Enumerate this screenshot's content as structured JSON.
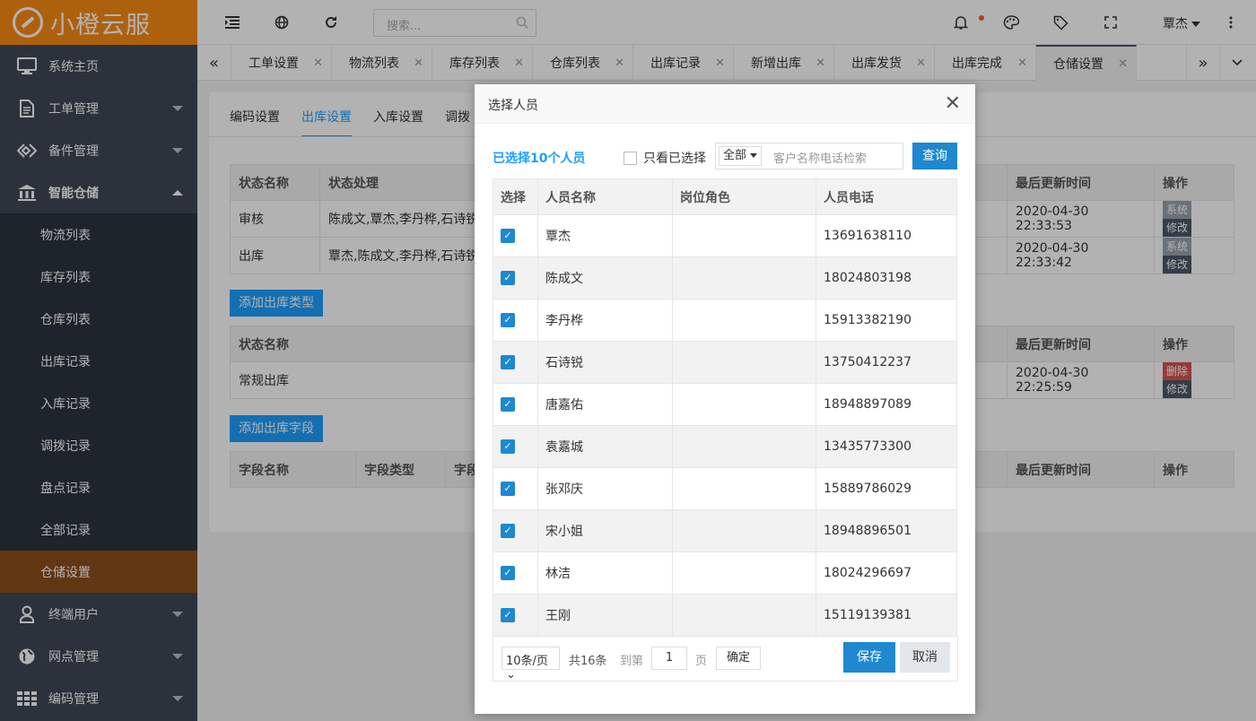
{
  "app": {
    "logo_text": "小橙云服"
  },
  "sidebar": {
    "top_items": [
      {
        "label": "系统主页",
        "icon": "monitor-icon"
      },
      {
        "label": "工单管理",
        "icon": "document-icon"
      },
      {
        "label": "备件管理",
        "icon": "parts-icon"
      },
      {
        "label": "智能仓储",
        "icon": "bank-icon"
      }
    ],
    "sub_items": [
      "物流列表",
      "库存列表",
      "仓库列表",
      "出库记录",
      "入库记录",
      "调拨记录",
      "盘点记录",
      "全部记录",
      "仓储设置"
    ],
    "bottom_items": [
      {
        "label": "终端用户",
        "icon": "user-icon"
      },
      {
        "label": "网点管理",
        "icon": "globe-icon"
      },
      {
        "label": "编码管理",
        "icon": "grid-icon"
      }
    ]
  },
  "topbar": {
    "search_placeholder": "搜索...",
    "user_name": "覃杰"
  },
  "tabs": [
    "工单设置",
    "物流列表",
    "库存列表",
    "仓库列表",
    "出库记录",
    "新增出库",
    "出库发货",
    "出库完成",
    "仓储设置"
  ],
  "page": {
    "subtabs": [
      "编码设置",
      "出库设置",
      "入库设置",
      "调拨"
    ],
    "table1": {
      "headers": [
        "状态名称",
        "状态处理",
        "最后更新时间",
        "操作"
      ],
      "rows": [
        {
          "name": "审核",
          "handler": "陈成文,覃杰,李丹桦,石诗锐",
          "time": "2020-04-30 22:33:53"
        },
        {
          "name": "出库",
          "handler": "覃杰,陈成文,李丹桦,石诗锐",
          "time": "2020-04-30 22:33:42"
        }
      ]
    },
    "add_type_btn": "添加出库类型",
    "table2": {
      "headers": [
        "状态名称",
        "最后更新时间",
        "操作"
      ],
      "rows": [
        {
          "name": "常规出库",
          "time": "2020-04-30 22:25:59"
        }
      ]
    },
    "add_field_btn": "添加出库字段",
    "table3": {
      "headers": [
        "字段名称",
        "字段类型",
        "字段",
        "最后更新时间",
        "操作"
      ]
    },
    "btn_system": "系统",
    "btn_edit": "修改",
    "btn_delete": "删除"
  },
  "dialog": {
    "title": "选择人员",
    "selected_info": "已选择10个人员",
    "only_selected": "只看已选择",
    "filter_option": "全部",
    "filter_placeholder": "客户名称电话检索",
    "query_btn": "查询",
    "headers": [
      "选择",
      "人员名称",
      "岗位角色",
      "人员电话"
    ],
    "rows": [
      {
        "name": "覃杰",
        "role": "",
        "phone": "13691638110"
      },
      {
        "name": "陈成文",
        "role": "",
        "phone": "18024803198"
      },
      {
        "name": "李丹桦",
        "role": "",
        "phone": "15913382190"
      },
      {
        "name": "石诗锐",
        "role": "",
        "phone": "13750412237"
      },
      {
        "name": "唐嘉佑",
        "role": "",
        "phone": "18948897089"
      },
      {
        "name": "袁嘉城",
        "role": "",
        "phone": "13435773300"
      },
      {
        "name": "张邓庆",
        "role": "",
        "phone": "15889786029"
      },
      {
        "name": "宋小姐",
        "role": "",
        "phone": "18948896501"
      },
      {
        "name": "林洁",
        "role": "",
        "phone": "18024296697"
      },
      {
        "name": "王刚",
        "role": "",
        "phone": "15119139381"
      }
    ],
    "pager": {
      "page_size": "10条/页",
      "total": "共16条",
      "goto": "到第",
      "page": "1",
      "page_unit": "页",
      "confirm": "确定"
    },
    "save_btn": "保存",
    "cancel_btn": "取消"
  }
}
